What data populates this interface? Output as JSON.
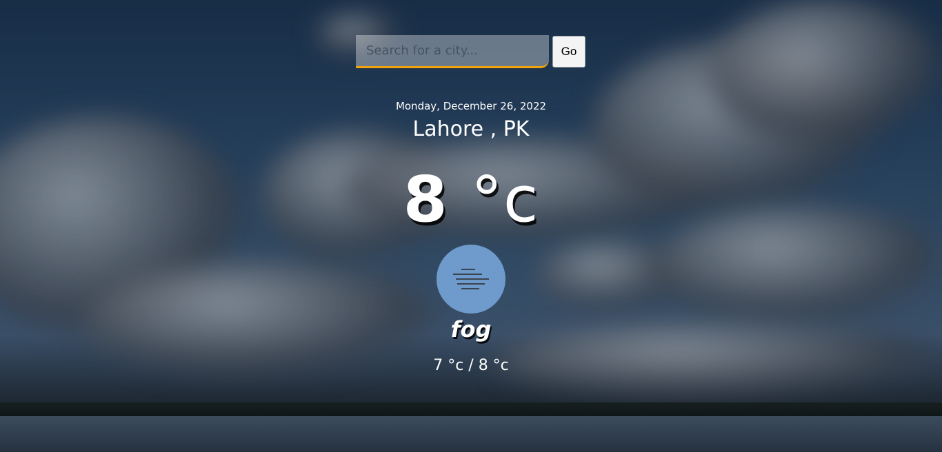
{
  "search": {
    "placeholder": "Search for a city...",
    "value": "",
    "go_label": "Go"
  },
  "weather": {
    "date": "Monday, December 26, 2022",
    "location": "Lahore , PK",
    "temp_value": "8",
    "temp_unit": "°c",
    "condition": "fog",
    "icon": "fog-icon",
    "min_max": "7 °c / 8 °c"
  },
  "colors": {
    "accent": "#f0a30a",
    "icon_circle": "#6f9bcc"
  }
}
